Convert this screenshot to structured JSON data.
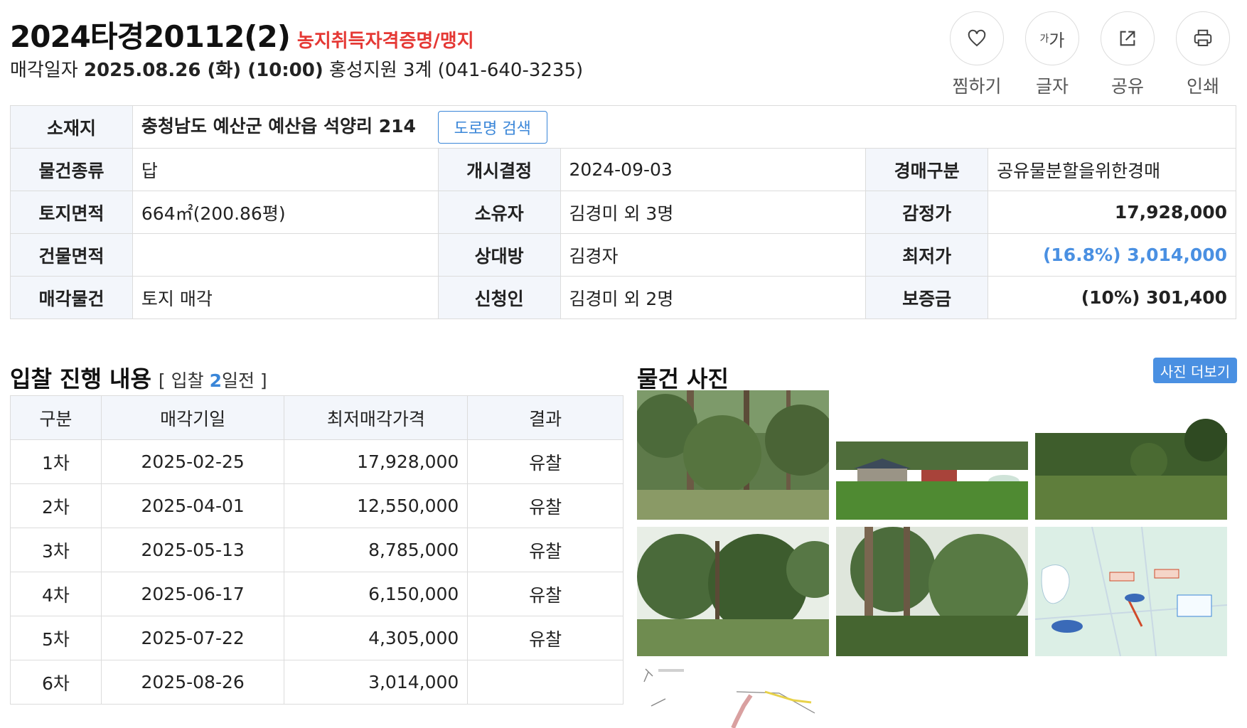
{
  "header": {
    "case_no": "2024타경20112(2)",
    "farm_tag": "농지취득자격증명/맹지",
    "sale_label": "매각일자",
    "sale_date": "2025.08.26 (화) (10:00)",
    "court": "홍성지원 3계 (041-640-3235)"
  },
  "actions": [
    {
      "label": "찜하기",
      "icon": "heart-icon"
    },
    {
      "label": "글자",
      "icon": "font-size-icon",
      "glyph_small": "가",
      "glyph_big": "가"
    },
    {
      "label": "공유",
      "icon": "share-icon"
    },
    {
      "label": "인쇄",
      "icon": "print-icon"
    }
  ],
  "info": {
    "location_label": "소재지",
    "location_value": "충청남도 예산군 예산읍 석양리 214",
    "road_search": "도로명 검색",
    "rows": [
      [
        {
          "h": "물건종류",
          "v": "답"
        },
        {
          "h": "개시결정",
          "v": "2024-09-03"
        },
        {
          "h": "경매구분",
          "v": "공유물분할을위한경매"
        }
      ],
      [
        {
          "h": "토지면적",
          "v": "664㎡(200.86평)"
        },
        {
          "h": "소유자",
          "v": "김경미 외 3명"
        },
        {
          "h": "감정가",
          "v": "17,928,000"
        }
      ],
      [
        {
          "h": "건물면적",
          "v": ""
        },
        {
          "h": "상대방",
          "v": "김경자"
        },
        {
          "h": "최저가",
          "v": "(16.8%) 3,014,000"
        }
      ],
      [
        {
          "h": "매각물건",
          "v": "토지 매각"
        },
        {
          "h": "신청인",
          "v": "김경미 외 2명"
        },
        {
          "h": "보증금",
          "v": "(10%) 301,400"
        }
      ]
    ]
  },
  "bidding": {
    "title": "입찰 진행 내용",
    "sub_prefix": "[ 입찰",
    "sub_count": "2",
    "sub_suffix": "일전 ]",
    "headers": [
      "구분",
      "매각기일",
      "최저매각가격",
      "결과"
    ],
    "rows": [
      [
        "1차",
        "2025-02-25",
        "17,928,000",
        "유찰"
      ],
      [
        "2차",
        "2025-04-01",
        "12,550,000",
        "유찰"
      ],
      [
        "3차",
        "2025-05-13",
        "8,785,000",
        "유찰"
      ],
      [
        "4차",
        "2025-06-17",
        "6,150,000",
        "유찰"
      ],
      [
        "5차",
        "2025-07-22",
        "4,305,000",
        "유찰"
      ],
      [
        "6차",
        "2025-08-26",
        "3,014,000",
        ""
      ]
    ]
  },
  "photos": {
    "title": "물건 사진",
    "more": "사진 더보기"
  },
  "colors": {
    "accent": "#4a90e2",
    "warning": "#e53935",
    "header_bg": "#f3f6fb"
  }
}
